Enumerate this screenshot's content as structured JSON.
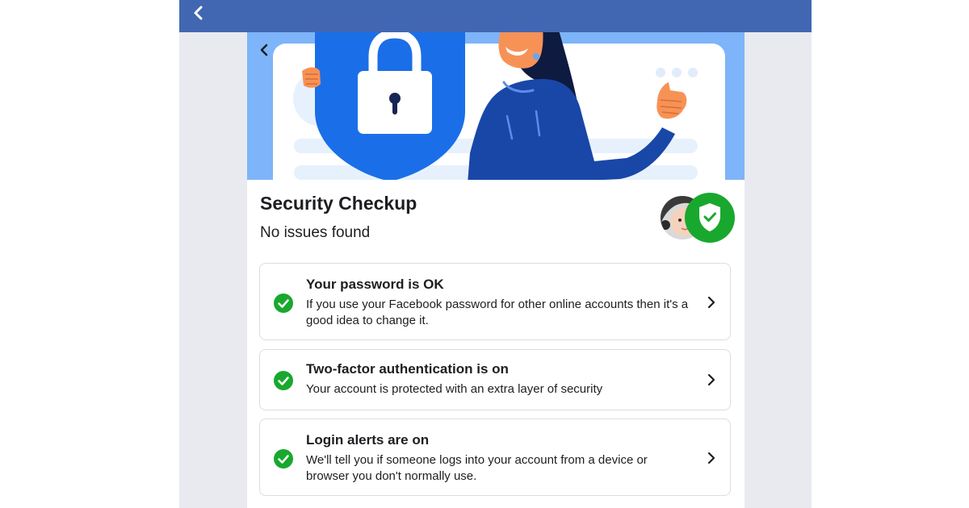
{
  "header": {
    "back_icon": "chevron-left-icon",
    "color": "#4267b2"
  },
  "hero": {
    "back_icon": "chevron-left-icon",
    "illustration": "woman holding padlock shield giving thumbs up"
  },
  "page": {
    "title": "Security Checkup",
    "subtitle": "No issues found"
  },
  "status": {
    "avatar": "baby-avatar",
    "badge_icon": "shield-check-icon",
    "badge_color": "#19a82e"
  },
  "items": [
    {
      "title": "Your password is OK",
      "description": "If you use your Facebook password for other online accounts then it's a good idea to change it.",
      "status_icon": "check-circle-icon",
      "chevron_icon": "chevron-right-icon"
    },
    {
      "title": "Two-factor authentication is on",
      "description": "Your account is protected with an extra layer of security",
      "status_icon": "check-circle-icon",
      "chevron_icon": "chevron-right-icon"
    },
    {
      "title": "Login alerts are on",
      "description": "We'll tell you if someone logs into your account from a device or browser you don't normally use.",
      "status_icon": "check-circle-icon",
      "chevron_icon": "chevron-right-icon"
    }
  ],
  "colors": {
    "accent_blue": "#1877f2",
    "success_green": "#19a82e",
    "text_primary": "#1c1e21"
  }
}
